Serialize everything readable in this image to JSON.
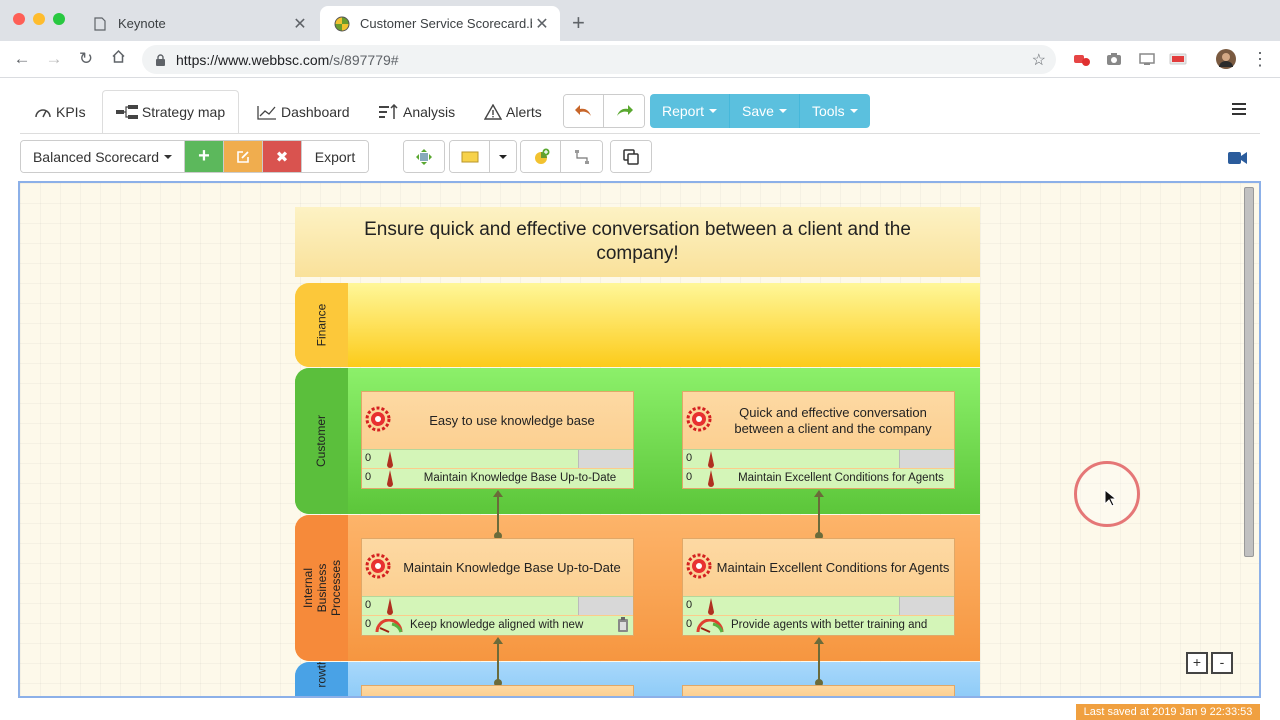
{
  "browser": {
    "tabs": [
      {
        "label": "Keynote"
      },
      {
        "label": "Customer Service Scorecard.b"
      }
    ],
    "url_host": "https://www.webbsc.com",
    "url_path": "/s/897779#"
  },
  "app": {
    "nav": {
      "kpis": "KPIs",
      "strategy_map": "Strategy map",
      "dashboard": "Dashboard",
      "analysis": "Analysis",
      "alerts": "Alerts"
    },
    "menus": {
      "report": "Report",
      "save": "Save",
      "tools": "Tools"
    },
    "scorecard_select": "Balanced Scorecard",
    "export_label": "Export",
    "add_symbol": "+",
    "delete_symbol": "✖"
  },
  "map": {
    "mission": "Ensure quick and effective conversation between a client and the company!",
    "lanes": {
      "finance": "Finance",
      "customer": "Customer",
      "ibp": "Internal Business Processes",
      "growth": "rowth"
    },
    "objectives": [
      {
        "title": "Easy to use knowledge base",
        "m1_value": "0",
        "m2_value": "0",
        "m2_text": "Maintain Knowledge Base Up-to-Date"
      },
      {
        "title": "Quick and effective conversation between a client and the company",
        "m1_value": "0",
        "m2_value": "0",
        "m2_text": "Maintain Excellent Conditions for Agents"
      },
      {
        "title": "Maintain Knowledge Base Up-to-Date",
        "m1_value": "0",
        "m2_value": "0",
        "m2_text": "Keep knowledge aligned with new"
      },
      {
        "title": "Maintain Excellent Conditions for Agents",
        "m1_value": "0",
        "m2_value": "0",
        "m2_text": "Provide agents with better training and"
      }
    ],
    "zoom_in": "+",
    "zoom_out": "-"
  },
  "status": {
    "last_saved": "Last saved at 2019 Jan 9 22:33:53"
  },
  "colors": {
    "accent_blue": "#5bc0de",
    "add_green": "#5cb85c",
    "edit_orange": "#f0ad4e",
    "delete_red": "#d9534f"
  }
}
